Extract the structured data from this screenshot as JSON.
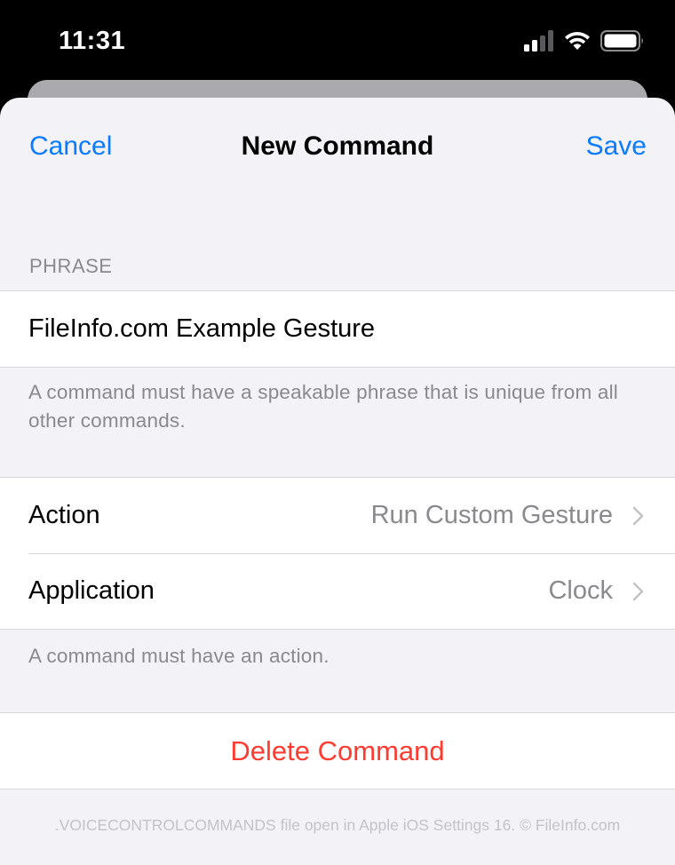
{
  "status_bar": {
    "time": "11:31",
    "icons": [
      "cellular-signal-icon",
      "wifi-icon",
      "battery-icon"
    ]
  },
  "nav": {
    "cancel_label": "Cancel",
    "title": "New Command",
    "save_label": "Save"
  },
  "phrase_section": {
    "header": "PHRASE",
    "value": "FileInfo.com Example Gesture",
    "footer": "A command must have a speakable phrase that is unique from all other commands."
  },
  "settings_section": {
    "rows": [
      {
        "label": "Action",
        "value": "Run Custom Gesture"
      },
      {
        "label": "Application",
        "value": "Clock"
      }
    ],
    "footer": "A command must have an action."
  },
  "delete_section": {
    "label": "Delete Command"
  },
  "watermark": ".VOICECONTROLCOMMANDS file open in Apple iOS Settings 16. © FileInfo.com",
  "colors": {
    "accent": "#0a7aff",
    "destructive": "#ff3b30",
    "background": "#f2f2f7",
    "secondary_text": "#8a8a8e"
  }
}
